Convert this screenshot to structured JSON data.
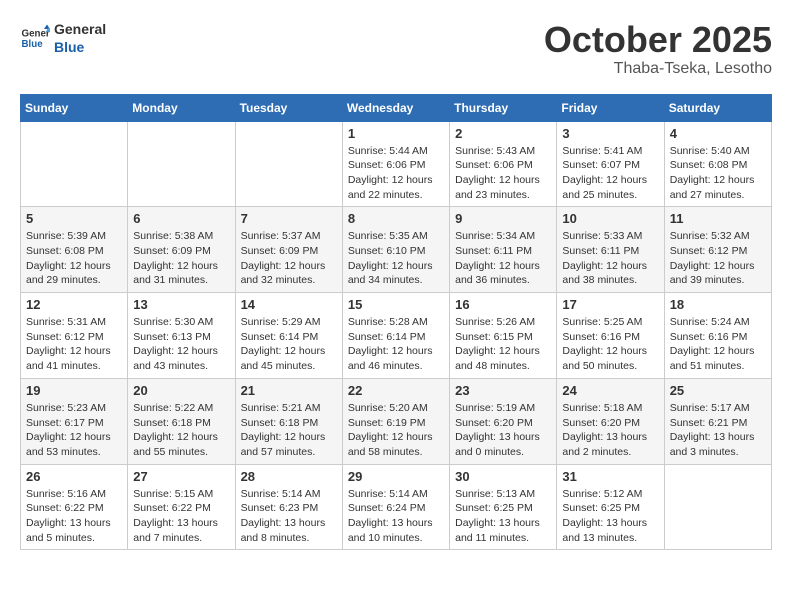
{
  "logo": {
    "line1": "General",
    "line2": "Blue"
  },
  "title": "October 2025",
  "location": "Thaba-Tseka, Lesotho",
  "days_of_week": [
    "Sunday",
    "Monday",
    "Tuesday",
    "Wednesday",
    "Thursday",
    "Friday",
    "Saturday"
  ],
  "weeks": [
    [
      {
        "day": "",
        "info": ""
      },
      {
        "day": "",
        "info": ""
      },
      {
        "day": "",
        "info": ""
      },
      {
        "day": "1",
        "info": "Sunrise: 5:44 AM\nSunset: 6:06 PM\nDaylight: 12 hours\nand 22 minutes."
      },
      {
        "day": "2",
        "info": "Sunrise: 5:43 AM\nSunset: 6:06 PM\nDaylight: 12 hours\nand 23 minutes."
      },
      {
        "day": "3",
        "info": "Sunrise: 5:41 AM\nSunset: 6:07 PM\nDaylight: 12 hours\nand 25 minutes."
      },
      {
        "day": "4",
        "info": "Sunrise: 5:40 AM\nSunset: 6:08 PM\nDaylight: 12 hours\nand 27 minutes."
      }
    ],
    [
      {
        "day": "5",
        "info": "Sunrise: 5:39 AM\nSunset: 6:08 PM\nDaylight: 12 hours\nand 29 minutes."
      },
      {
        "day": "6",
        "info": "Sunrise: 5:38 AM\nSunset: 6:09 PM\nDaylight: 12 hours\nand 31 minutes."
      },
      {
        "day": "7",
        "info": "Sunrise: 5:37 AM\nSunset: 6:09 PM\nDaylight: 12 hours\nand 32 minutes."
      },
      {
        "day": "8",
        "info": "Sunrise: 5:35 AM\nSunset: 6:10 PM\nDaylight: 12 hours\nand 34 minutes."
      },
      {
        "day": "9",
        "info": "Sunrise: 5:34 AM\nSunset: 6:11 PM\nDaylight: 12 hours\nand 36 minutes."
      },
      {
        "day": "10",
        "info": "Sunrise: 5:33 AM\nSunset: 6:11 PM\nDaylight: 12 hours\nand 38 minutes."
      },
      {
        "day": "11",
        "info": "Sunrise: 5:32 AM\nSunset: 6:12 PM\nDaylight: 12 hours\nand 39 minutes."
      }
    ],
    [
      {
        "day": "12",
        "info": "Sunrise: 5:31 AM\nSunset: 6:12 PM\nDaylight: 12 hours\nand 41 minutes."
      },
      {
        "day": "13",
        "info": "Sunrise: 5:30 AM\nSunset: 6:13 PM\nDaylight: 12 hours\nand 43 minutes."
      },
      {
        "day": "14",
        "info": "Sunrise: 5:29 AM\nSunset: 6:14 PM\nDaylight: 12 hours\nand 45 minutes."
      },
      {
        "day": "15",
        "info": "Sunrise: 5:28 AM\nSunset: 6:14 PM\nDaylight: 12 hours\nand 46 minutes."
      },
      {
        "day": "16",
        "info": "Sunrise: 5:26 AM\nSunset: 6:15 PM\nDaylight: 12 hours\nand 48 minutes."
      },
      {
        "day": "17",
        "info": "Sunrise: 5:25 AM\nSunset: 6:16 PM\nDaylight: 12 hours\nand 50 minutes."
      },
      {
        "day": "18",
        "info": "Sunrise: 5:24 AM\nSunset: 6:16 PM\nDaylight: 12 hours\nand 51 minutes."
      }
    ],
    [
      {
        "day": "19",
        "info": "Sunrise: 5:23 AM\nSunset: 6:17 PM\nDaylight: 12 hours\nand 53 minutes."
      },
      {
        "day": "20",
        "info": "Sunrise: 5:22 AM\nSunset: 6:18 PM\nDaylight: 12 hours\nand 55 minutes."
      },
      {
        "day": "21",
        "info": "Sunrise: 5:21 AM\nSunset: 6:18 PM\nDaylight: 12 hours\nand 57 minutes."
      },
      {
        "day": "22",
        "info": "Sunrise: 5:20 AM\nSunset: 6:19 PM\nDaylight: 12 hours\nand 58 minutes."
      },
      {
        "day": "23",
        "info": "Sunrise: 5:19 AM\nSunset: 6:20 PM\nDaylight: 13 hours\nand 0 minutes."
      },
      {
        "day": "24",
        "info": "Sunrise: 5:18 AM\nSunset: 6:20 PM\nDaylight: 13 hours\nand 2 minutes."
      },
      {
        "day": "25",
        "info": "Sunrise: 5:17 AM\nSunset: 6:21 PM\nDaylight: 13 hours\nand 3 minutes."
      }
    ],
    [
      {
        "day": "26",
        "info": "Sunrise: 5:16 AM\nSunset: 6:22 PM\nDaylight: 13 hours\nand 5 minutes."
      },
      {
        "day": "27",
        "info": "Sunrise: 5:15 AM\nSunset: 6:22 PM\nDaylight: 13 hours\nand 7 minutes."
      },
      {
        "day": "28",
        "info": "Sunrise: 5:14 AM\nSunset: 6:23 PM\nDaylight: 13 hours\nand 8 minutes."
      },
      {
        "day": "29",
        "info": "Sunrise: 5:14 AM\nSunset: 6:24 PM\nDaylight: 13 hours\nand 10 minutes."
      },
      {
        "day": "30",
        "info": "Sunrise: 5:13 AM\nSunset: 6:25 PM\nDaylight: 13 hours\nand 11 minutes."
      },
      {
        "day": "31",
        "info": "Sunrise: 5:12 AM\nSunset: 6:25 PM\nDaylight: 13 hours\nand 13 minutes."
      },
      {
        "day": "",
        "info": ""
      }
    ]
  ]
}
